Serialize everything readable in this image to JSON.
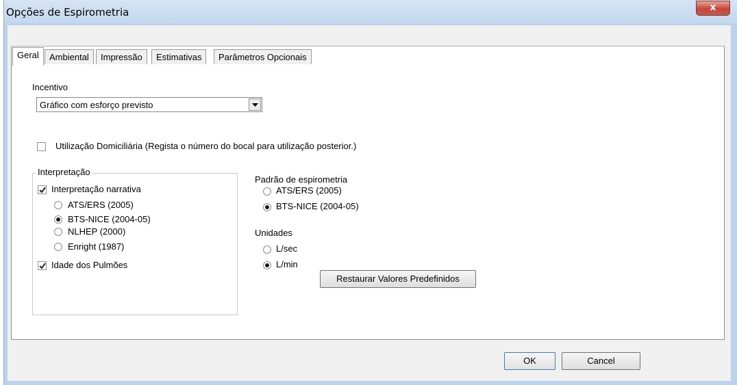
{
  "window": {
    "title": "Opções de Espirometria",
    "close_symbol": "x"
  },
  "tabs": [
    {
      "label": "Geral"
    },
    {
      "label": "Ambiental"
    },
    {
      "label": "Impressão"
    },
    {
      "label": "Estimativas"
    },
    {
      "label": "Parâmetros Opcionais"
    }
  ],
  "incentivo": {
    "label": "Incentivo",
    "selected": "Gráfico com esforço previsto"
  },
  "home_use": {
    "label": "Utilização Domiciliária (Regista o número do bocal para utilização posterior.)",
    "checked": false
  },
  "interpretation": {
    "group_label": "Interpretação",
    "narrative_label": "Interpretação narrativa",
    "narrative_checked": true,
    "options": [
      "ATS/ERS (2005)",
      "BTS-NICE (2004-05)",
      "NLHEP (2000)",
      "Enright (1987)"
    ],
    "selected_option": "BTS-NICE (2004-05)",
    "lung_age_label": "Idade dos Pulmões",
    "lung_age_checked": true
  },
  "standard": {
    "label": "Padrão de espirometria",
    "options": [
      "ATS/ERS (2005)",
      "BTS-NICE (2004-05)"
    ],
    "selected_option": "BTS-NICE (2004-05)"
  },
  "units": {
    "label": "Unidades",
    "options": [
      "L/sec",
      "L/min"
    ],
    "selected_option": "L/min"
  },
  "buttons": {
    "restore": "Restaurar Valores Predefinidos",
    "ok": "OK",
    "cancel": "Cancel"
  },
  "icons": {
    "close": "close-icon",
    "dropdown": "chevron-down-icon",
    "check": "check-icon"
  }
}
